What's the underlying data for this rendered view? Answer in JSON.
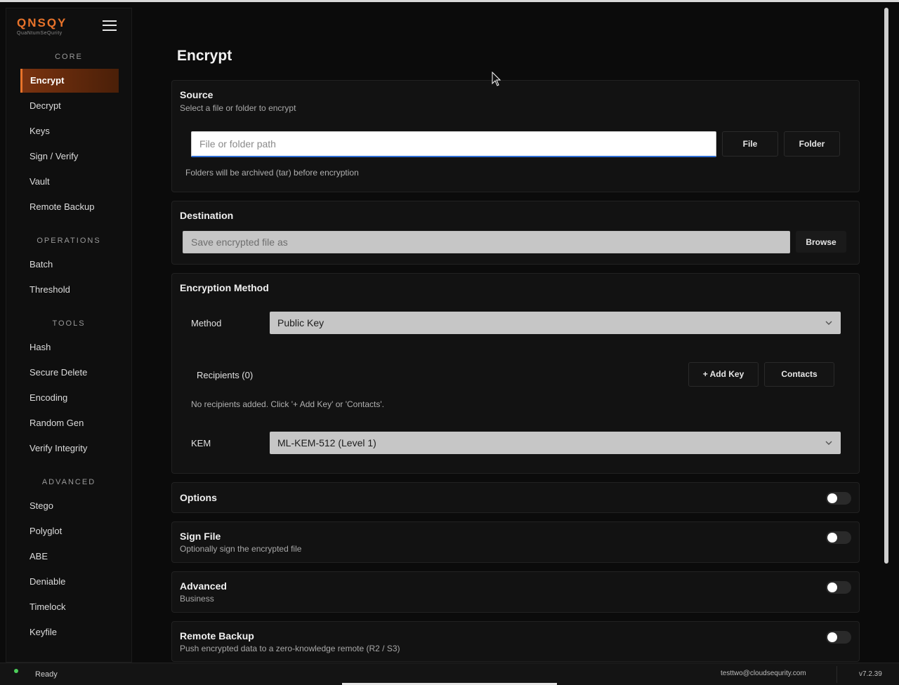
{
  "brand": {
    "logo": "QNSQY",
    "tagline": "QuaNtumSeQurity"
  },
  "sidebar": {
    "sections": [
      {
        "label": "CORE",
        "items": [
          "Encrypt",
          "Decrypt",
          "Keys",
          "Sign / Verify",
          "Vault",
          "Remote Backup"
        ]
      },
      {
        "label": "OPERATIONS",
        "items": [
          "Batch",
          "Threshold"
        ]
      },
      {
        "label": "TOOLS",
        "items": [
          "Hash",
          "Secure Delete",
          "Encoding",
          "Random Gen",
          "Verify Integrity"
        ]
      },
      {
        "label": "ADVANCED",
        "items": [
          "Stego",
          "Polyglot",
          "ABE",
          "Deniable",
          "Timelock",
          "Keyfile"
        ]
      }
    ],
    "active": "Encrypt"
  },
  "page": {
    "title": "Encrypt"
  },
  "source": {
    "title": "Source",
    "subtitle": "Select a file or folder to encrypt",
    "placeholder": "File or folder path",
    "file_label": "File",
    "folder_label": "Folder",
    "hint": "Folders will be archived (tar) before encryption"
  },
  "destination": {
    "title": "Destination",
    "placeholder": "Save encrypted file as",
    "browse_label": "Browse"
  },
  "method_panel": {
    "title": "Encryption Method",
    "method_label": "Method",
    "method_value": "Public Key",
    "recipients_label": "Recipients (0)",
    "add_key_label": "+ Add Key",
    "contacts_label": "Contacts",
    "empty_text": "No recipients added. Click '+ Add Key' or 'Contacts'.",
    "kem_label": "KEM",
    "kem_value": "ML-KEM-512 (Level 1)"
  },
  "options": {
    "title": "Options"
  },
  "sign": {
    "title": "Sign File",
    "subtitle": "Optionally sign the encrypted file"
  },
  "advanced": {
    "title": "Advanced",
    "subtitle": "Business"
  },
  "remote": {
    "title": "Remote Backup",
    "subtitle": "Push encrypted data to a zero-knowledge remote (R2 / S3)"
  },
  "status": {
    "text": "Ready",
    "user": "testtwo@cloudsequrity.com",
    "version": "v7.2.39"
  },
  "colors": {
    "accent": "#e8732a",
    "status_ok": "#4ccf5a",
    "focus": "#2f6fd6"
  }
}
